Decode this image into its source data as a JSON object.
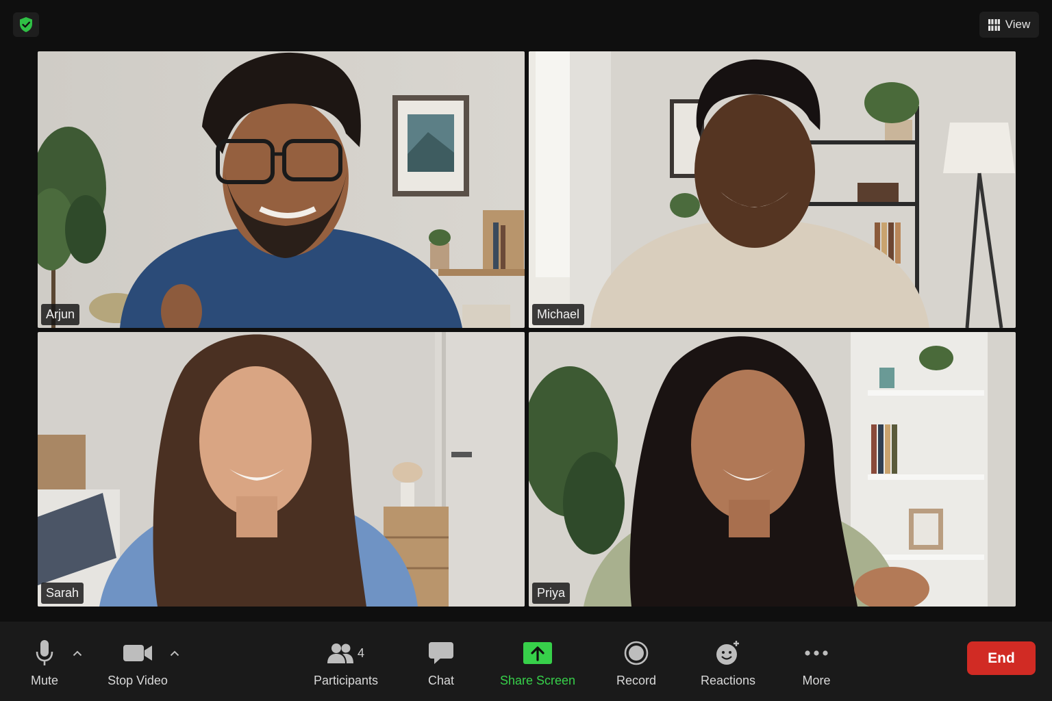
{
  "top_bar": {
    "security_icon": "shield-check-icon",
    "view_label": "View",
    "view_icon": "grid-icon"
  },
  "participants": [
    {
      "name": "Arjun"
    },
    {
      "name": "Michael"
    },
    {
      "name": "Sarah"
    },
    {
      "name": "Priya"
    }
  ],
  "controls": {
    "mute_label": "Mute",
    "stop_video_label": "Stop Video",
    "participants_label": "Participants",
    "participants_count": "4",
    "chat_label": "Chat",
    "share_screen_label": "Share Screen",
    "record_label": "Record",
    "reactions_label": "Reactions",
    "more_label": "More",
    "end_label": "End"
  },
  "colors": {
    "background": "#0f0f0f",
    "control_bar": "#1a1a1a",
    "share_accent": "#37d04a",
    "end_button": "#d12b24",
    "shield": "#2fbf45"
  }
}
